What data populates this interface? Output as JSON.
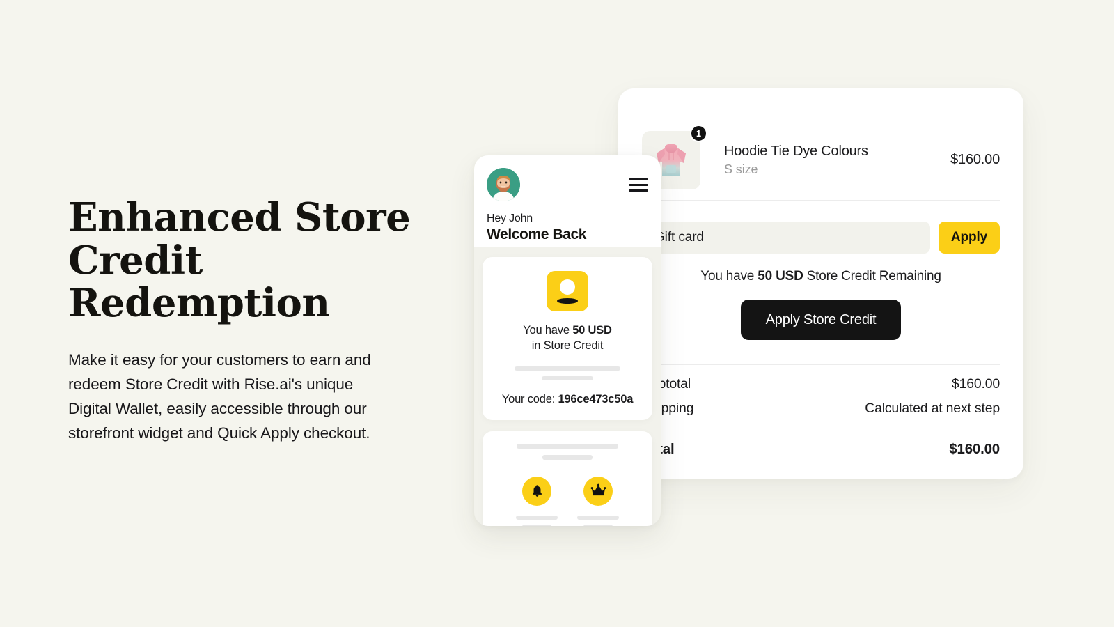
{
  "theme": {
    "background": "#f5f5ee",
    "accent_yellow": "#fbcf17",
    "dark": "#141414",
    "avatar_bg": "#3a9e84",
    "input_bg": "#f2f2ec"
  },
  "copy": {
    "headline_line1": "Enhanced Store",
    "headline_line2": "Credit Redemption",
    "body": "Make it easy for your customers to earn and redeem Store Credit with Rise.ai's unique Digital Wallet, easily accessible through our storefront widget and Quick Apply checkout."
  },
  "checkout": {
    "line_item": {
      "quantity_badge": "1",
      "title": "Hoodie Tie Dye Colours",
      "variant": "S size",
      "price": "$160.00",
      "thumbnail_icon": "hoodie-tie-dye-image"
    },
    "gift_card": {
      "placeholder": "Gift card",
      "value": "",
      "apply_label": "Apply"
    },
    "credit_note": {
      "prefix": "You have ",
      "amount": "50 USD",
      "suffix": " Store Credit Remaining"
    },
    "apply_store_credit_label": "Apply Store Credit",
    "totals": [
      {
        "label": "Subtotal",
        "value": "$160.00"
      },
      {
        "label": "Shipping",
        "value": "Calculated at next step"
      }
    ],
    "grand_total": {
      "label": "Total",
      "value": "$160.00"
    }
  },
  "phone": {
    "greeting": "Hey John",
    "welcome": "Welcome Back",
    "menu_icon": "hamburger-menu-icon",
    "avatar_icon": "user-avatar-photo",
    "wallet_card": {
      "icon": "wallet-card-icon",
      "credit_line1_prefix": "You have ",
      "credit_line1_amount": "50 USD",
      "credit_line2": "in Store Credit",
      "code_prefix": "Your code: ",
      "code_value": "196ce473c50a"
    },
    "rewards_card": {
      "items": [
        {
          "icon": "bell-icon",
          "glyph": "🔔"
        },
        {
          "icon": "crown-icon",
          "glyph": "♛"
        }
      ]
    }
  }
}
